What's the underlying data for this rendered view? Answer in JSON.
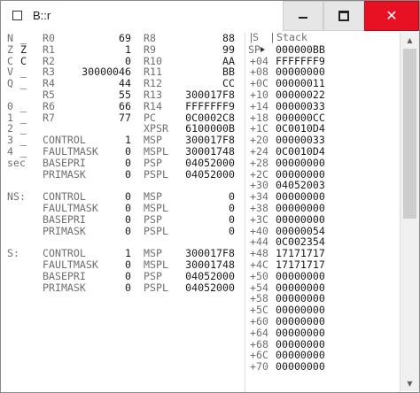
{
  "window": {
    "title": "B::r",
    "icons": {
      "app": "window-icon",
      "minimize": "minimize-icon",
      "maximize": "maximize-icon",
      "close": "close-icon"
    },
    "close_glyph": "✕",
    "close_color": "#e81123"
  },
  "flags": [
    {
      "name": "N",
      "value": "_"
    },
    {
      "name": "Z",
      "value": "Z"
    },
    {
      "name": "C",
      "value": "C"
    },
    {
      "name": "V",
      "value": "_"
    },
    {
      "name": "Q",
      "value": "_"
    },
    {
      "name": "",
      "value": ""
    },
    {
      "name": "0",
      "value": "_"
    },
    {
      "name": "1",
      "value": "_"
    },
    {
      "name": "2",
      "value": "_"
    },
    {
      "name": "3",
      "value": "_"
    },
    {
      "name": "4",
      "value": "_"
    },
    {
      "name": "sec",
      "value": ""
    }
  ],
  "gp_regs": [
    {
      "name": "R0",
      "value": "69"
    },
    {
      "name": "R1",
      "value": "1"
    },
    {
      "name": "R2",
      "value": "0"
    },
    {
      "name": "R3",
      "value": "30000046"
    },
    {
      "name": "R4",
      "value": "44"
    },
    {
      "name": "R5",
      "value": "55"
    },
    {
      "name": "R6",
      "value": "66"
    },
    {
      "name": "R7",
      "value": "77"
    }
  ],
  "hi_regs": [
    {
      "name": "R8",
      "value": "88"
    },
    {
      "name": "R9",
      "value": "99"
    },
    {
      "name": "R10",
      "value": "AA"
    },
    {
      "name": "R11",
      "value": "BB"
    },
    {
      "name": "R12",
      "value": "CC"
    },
    {
      "name": "R13",
      "value": "300017F8"
    },
    {
      "name": "R14",
      "value": "FFFFFFF9"
    },
    {
      "name": "PC",
      "value": "0C0002C8"
    },
    {
      "name": "XPSR",
      "value": "6100000B"
    }
  ],
  "groups": [
    {
      "prefix": "",
      "rows": [
        {
          "l": "CONTROL",
          "lv": "1",
          "r": "MSP",
          "rv": "300017F8"
        },
        {
          "l": "FAULTMASK",
          "lv": "0",
          "r": "MSPL",
          "rv": "30001748"
        },
        {
          "l": "BASEPRI",
          "lv": "0",
          "r": "PSP",
          "rv": "04052000"
        },
        {
          "l": "PRIMASK",
          "lv": "0",
          "r": "PSPL",
          "rv": "04052000"
        }
      ]
    },
    {
      "prefix": "NS:",
      "rows": [
        {
          "l": "CONTROL",
          "lv": "0",
          "r": "MSP",
          "rv": "0"
        },
        {
          "l": "FAULTMASK",
          "lv": "0",
          "r": "MSPL",
          "rv": "0"
        },
        {
          "l": "BASEPRI",
          "lv": "0",
          "r": "PSP",
          "rv": "0"
        },
        {
          "l": "PRIMASK",
          "lv": "0",
          "r": "PSPL",
          "rv": "0"
        }
      ]
    },
    {
      "prefix": "S:",
      "rows": [
        {
          "l": "CONTROL",
          "lv": "1",
          "r": "MSP",
          "rv": "300017F8"
        },
        {
          "l": "FAULTMASK",
          "lv": "0",
          "r": "MSPL",
          "rv": "30001748"
        },
        {
          "l": "BASEPRI",
          "lv": "0",
          "r": "PSP",
          "rv": "04052000"
        },
        {
          "l": "PRIMASK",
          "lv": "0",
          "r": "PSPL",
          "rv": "04052000"
        }
      ]
    }
  ],
  "stack": {
    "header_s": "S",
    "header_stack": "Stack",
    "pointer_label": "SP",
    "rows": [
      {
        "off": "SP",
        "val": "000000BB"
      },
      {
        "off": "+04",
        "val": "FFFFFFF9"
      },
      {
        "off": "+08",
        "val": "00000000"
      },
      {
        "off": "+0C",
        "val": "00000011"
      },
      {
        "off": "+10",
        "val": "00000022"
      },
      {
        "off": "+14",
        "val": "00000033"
      },
      {
        "off": "+18",
        "val": "000000CC"
      },
      {
        "off": "+1C",
        "val": "0C0010D4"
      },
      {
        "off": "+20",
        "val": "00000033"
      },
      {
        "off": "+24",
        "val": "0C0010D4"
      },
      {
        "off": "+28",
        "val": "00000000"
      },
      {
        "off": "+2C",
        "val": "00000000"
      },
      {
        "off": "+30",
        "val": "04052003"
      },
      {
        "off": "+34",
        "val": "00000000"
      },
      {
        "off": "+38",
        "val": "00000000"
      },
      {
        "off": "+3C",
        "val": "00000000"
      },
      {
        "off": "+40",
        "val": "00000054"
      },
      {
        "off": "+44",
        "val": "0C002354"
      },
      {
        "off": "+48",
        "val": "17171717"
      },
      {
        "off": "+4C",
        "val": "17171717"
      },
      {
        "off": "+50",
        "val": "00000000"
      },
      {
        "off": "+54",
        "val": "00000000"
      },
      {
        "off": "+58",
        "val": "00000000"
      },
      {
        "off": "+5C",
        "val": "00000000"
      },
      {
        "off": "+60",
        "val": "00000000"
      },
      {
        "off": "+64",
        "val": "00000000"
      },
      {
        "off": "+68",
        "val": "00000000"
      },
      {
        "off": "+6C",
        "val": "00000000"
      },
      {
        "off": "+70",
        "val": "00000000"
      }
    ]
  },
  "scrollbar": {
    "up_glyph": "▲",
    "down_glyph": "▼",
    "up_icon": "scroll-up-icon",
    "down_icon": "scroll-down-icon"
  }
}
